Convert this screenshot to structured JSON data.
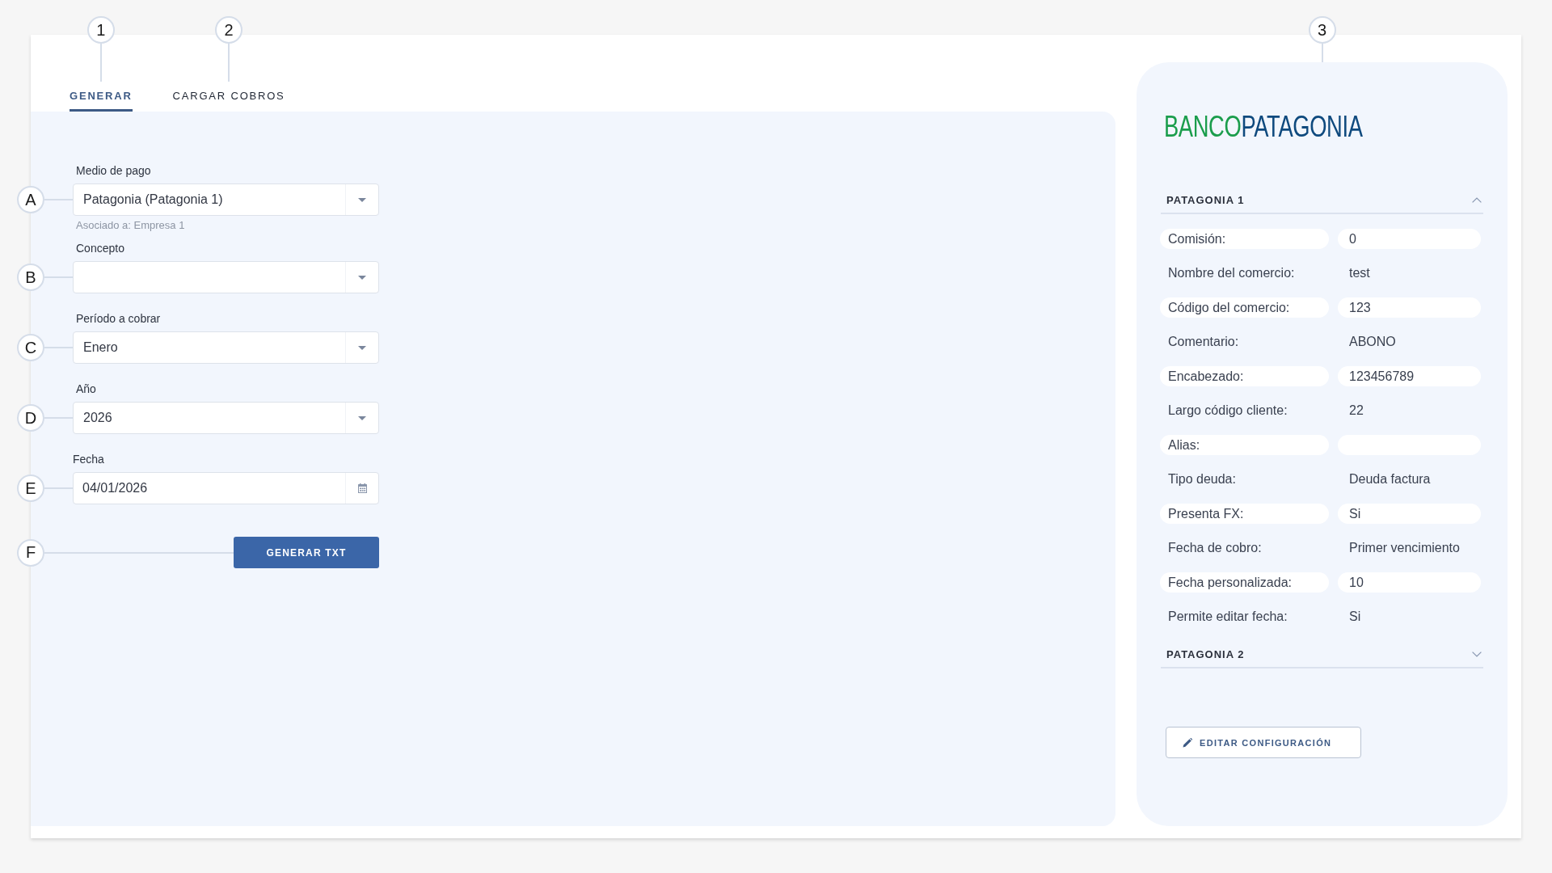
{
  "tabs": [
    {
      "label": "GENERAR",
      "selected": true,
      "callout": "1"
    },
    {
      "label": "CARGAR COBROS",
      "selected": false,
      "callout": "2"
    }
  ],
  "form": {
    "fields": [
      {
        "kind": "select",
        "label": "Medio de pago",
        "value": "Patagonia (Patagonia 1)",
        "hint": "Asociado a: Empresa 1",
        "callout": "A"
      },
      {
        "kind": "select",
        "label": "Concepto",
        "callout": "B"
      },
      {
        "kind": "select",
        "label": "Período a cobrar",
        "value": "Enero",
        "callout": "C"
      },
      {
        "kind": "select",
        "label": "Año",
        "value": "2026",
        "callout": "D"
      },
      {
        "kind": "date",
        "label": "Fecha",
        "value": "04/01/2026",
        "callout": "E"
      }
    ],
    "submit": {
      "label": "GENERAR TXT",
      "callout": "F"
    }
  },
  "bank_panel": {
    "callout": "3",
    "logo": [
      {
        "text": "BANCO",
        "color": "#1b9d4c"
      },
      {
        "text": "PATAGONIA",
        "color": "#0f4a7e"
      }
    ],
    "sections": [
      {
        "title": "PATAGONIA 1",
        "expanded": true,
        "rows": [
          {
            "label": "Comisión:",
            "value": "0"
          },
          {
            "label": "Nombre del comercio:",
            "value": "test"
          },
          {
            "label": "Código del comercio:",
            "value": "123"
          },
          {
            "label": "Comentario:",
            "value": "ABONO"
          },
          {
            "label": "Encabezado:",
            "value": "123456789"
          },
          {
            "label": "Largo código cliente:",
            "value": "22"
          },
          {
            "label": "Alias:"
          },
          {
            "label": "Tipo deuda:",
            "value": "Deuda factura"
          },
          {
            "label": "Presenta FX:",
            "value": "Si"
          },
          {
            "label": "Fecha de cobro:",
            "value": "Primer vencimiento"
          },
          {
            "label": "Fecha personalizada:",
            "value": "10"
          },
          {
            "label": "Permite editar fecha:",
            "value": "Si"
          }
        ]
      },
      {
        "title": "PATAGONIA 2",
        "expanded": false
      }
    ],
    "edit_button": {
      "label": "EDITAR CONFIGURACIÓN"
    }
  }
}
